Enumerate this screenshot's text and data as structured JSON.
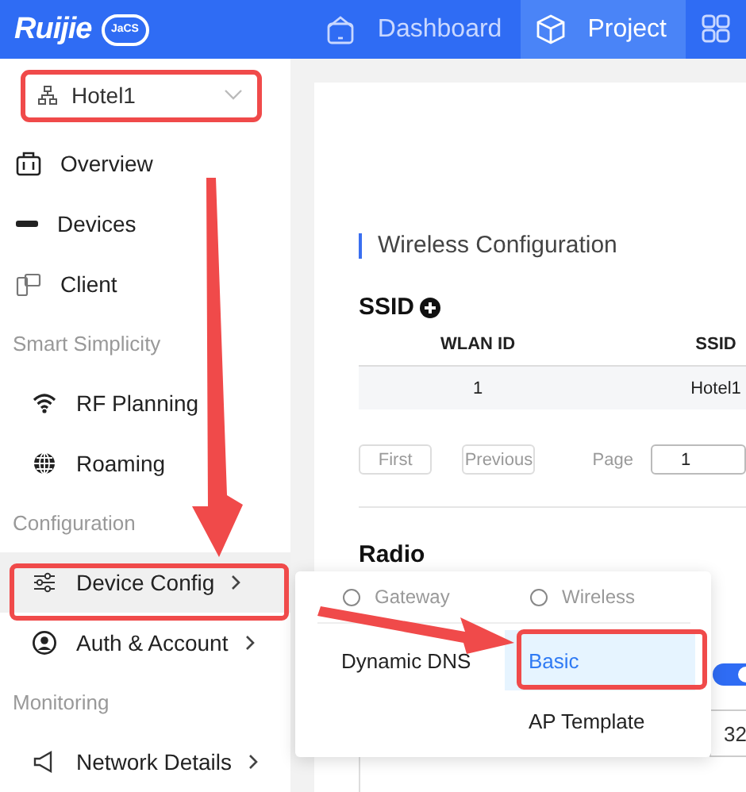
{
  "header": {
    "logo": "Ruijie",
    "logo_badge": "JaCS",
    "nav": [
      {
        "kind": "dashboard",
        "label": "Dashboard",
        "selected": false
      },
      {
        "kind": "project",
        "label": "Project",
        "selected": true
      },
      {
        "kind": "apps",
        "selected": false
      }
    ]
  },
  "sidebar": {
    "project_select": {
      "value": "Hotel1"
    },
    "items": [
      {
        "kind": "item",
        "label": "Overview",
        "selected": false,
        "submenu": false
      },
      {
        "kind": "item",
        "label": "Devices",
        "selected": false,
        "submenu": false
      },
      {
        "kind": "item",
        "label": "Client",
        "selected": false,
        "submenu": false
      },
      {
        "kind": "section",
        "label": "Smart Simplicity"
      },
      {
        "kind": "subitem",
        "label": "RF Planning",
        "selected": false,
        "submenu": false
      },
      {
        "kind": "subitem",
        "label": "Roaming",
        "selected": false,
        "submenu": false
      },
      {
        "kind": "section",
        "label": "Configuration"
      },
      {
        "kind": "subitem",
        "label": "Device Config",
        "selected": true,
        "submenu": true
      },
      {
        "kind": "subitem",
        "label": "Auth & Account",
        "selected": false,
        "submenu": true
      },
      {
        "kind": "section",
        "label": "Monitoring"
      },
      {
        "kind": "subitem",
        "label": "Network Details",
        "selected": false,
        "submenu": true
      }
    ]
  },
  "content": {
    "section_title": "Wireless Configuration",
    "ssid": {
      "heading": "SSID",
      "table": {
        "columns": [
          "WLAN ID",
          "SSID"
        ],
        "rows": [
          [
            "1",
            "Hotel1"
          ]
        ]
      },
      "pagination": {
        "buttons": [
          "First",
          "Previous"
        ],
        "page_label": "Page",
        "page_value": "1"
      }
    },
    "radio": {
      "heading": "Radio",
      "switch_on": true,
      "field_value": "32"
    }
  },
  "popup_menu": {
    "columns": [
      {
        "title": "Gateway",
        "selected": false,
        "entries": [
          {
            "label": "Dynamic DNS",
            "selected": false
          }
        ]
      },
      {
        "title": "Wireless",
        "selected": false,
        "entries": [
          {
            "label": "Basic",
            "selected": true
          },
          {
            "label": "AP Template",
            "selected": false
          }
        ]
      }
    ]
  }
}
